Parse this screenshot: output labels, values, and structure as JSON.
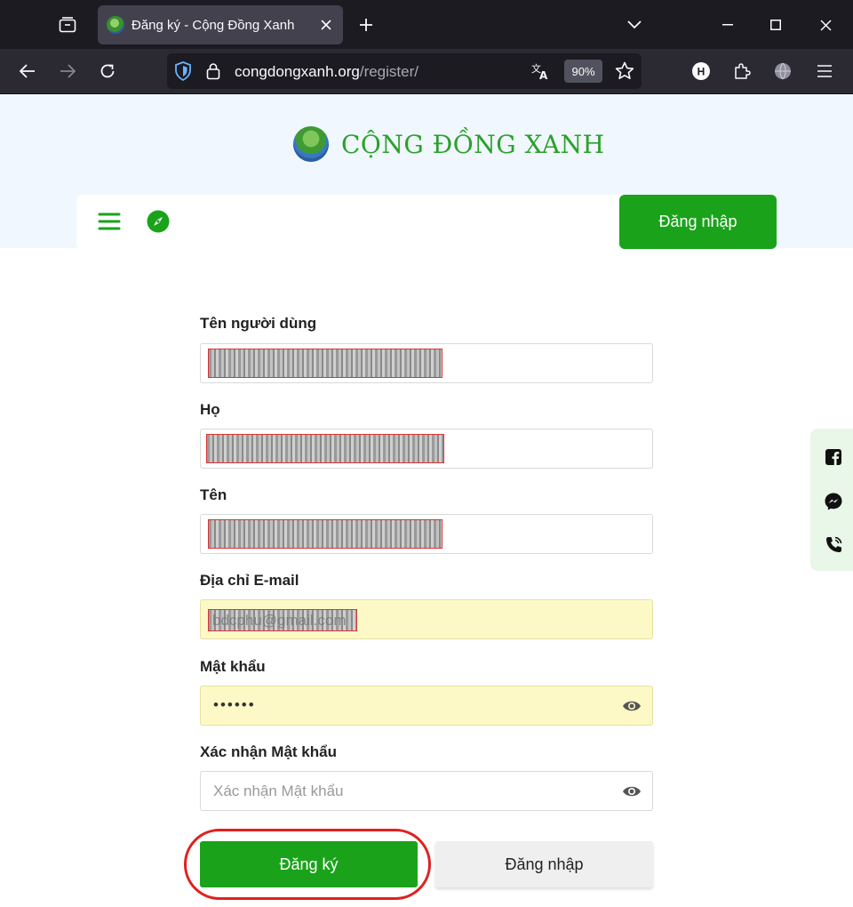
{
  "browser": {
    "tab_title": "Đăng ký - Cộng Đồng Xanh",
    "url_domain": "congdongxanh.org",
    "url_path": "/register/",
    "zoom_level": "90%",
    "profile_initial": "H"
  },
  "site": {
    "logo_text": "CỘNG ĐỒNG XANH",
    "header_login_label": "Đăng nhập",
    "brand_color": "#1aa31a"
  },
  "form": {
    "username_label": "Tên người dùng",
    "lastname_label": "Họ",
    "firstname_label": "Tên",
    "email_label": "Địa chỉ E-mail",
    "email_value_redacted": "bdcphu@gmail.com",
    "password_label": "Mật khẩu",
    "password_value": "••••••",
    "confirm_label": "Xác nhận Mật khẩu",
    "confirm_placeholder": "Xác nhận Mật khẩu",
    "register_button": "Đăng ký",
    "login_button": "Đăng nhập"
  },
  "icons": {
    "tab_list": "tab-list-icon",
    "social": [
      "facebook-icon",
      "messenger-icon",
      "phone-icon"
    ]
  }
}
